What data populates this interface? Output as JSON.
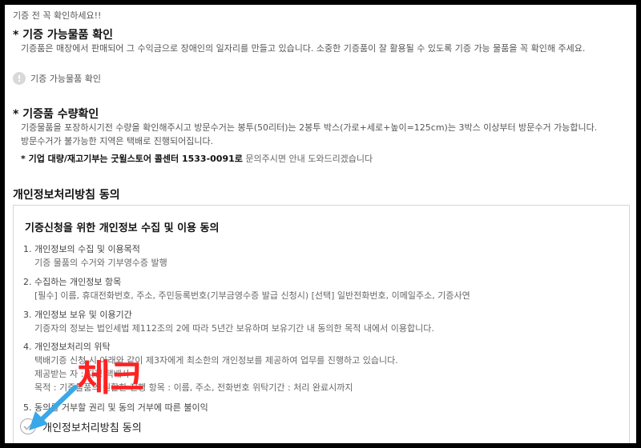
{
  "notice": "기증 전 꼭 확인하세요!!",
  "sections": {
    "goods": {
      "title": "* 기증 가능물품 확인",
      "desc": "기증품은 매장에서 판매되어 그 수익금으로 장애인의 일자리를 만들고 있습니다. 소중한 기증품이 잘 활용될 수 있도록 기증 가능 물품을 꼭 확인해 주세요.",
      "check_label": "기증 가능물품 확인",
      "check_icon": "exclamation-icon"
    },
    "quantity": {
      "title": "* 기증품 수량확인",
      "desc1": "기증물품을 포장하시기전 수량을 확인해주시고 방문수거는 봉투(50리터)는 2봉투 박스(가로+세로+높이=125cm)는 3박스 이상부터 방문수거 가능합니다.",
      "desc2": "방문수거가 불가능한 지역은 택배로 진행되어집니다.",
      "corp_strong": "* 기업 대량/재고기부는 굿윌스토어 콜센터 1533-0091로",
      "corp_weak": " 문의주시면 안내 도와드리겠습니다"
    }
  },
  "privacy": {
    "heading": "개인정보처리방침 동의",
    "box_title": "기증신청을 위한 개인정보 수집 및 이용 동의",
    "items": [
      {
        "h": "1. 개인정보의 수집 및 이용목적",
        "d": [
          "기증 물품의 수거와 기부영수증 발행"
        ]
      },
      {
        "h": "2. 수집하는 개인정보 항목",
        "d": [
          "[필수] 이름, 휴대전화번호, 주소, 주민등록번호(기부금영수증 발급 신청시) [선택] 일반전화번호, 이메일주소, 기증사연"
        ]
      },
      {
        "h": "3. 개인정보 보유 및 이용기간",
        "d": [
          "기증자의 정보는 법인세법 제112조의 2에 따라 5년간 보유하며 보유기간 내 동의한 목적 내에서 이용합니다."
        ]
      },
      {
        "h": "4. 개인정보처리의 위탁",
        "d": [
          "택배기증 신청 시 아래와 같이 제3자에게 최소한의 개인정보를 제공하여 업무를 진행하고 있습니다.",
          "제공받는 자 : 지정 택배사",
          "목적 : 기증물품의 원활한 진행 항목 : 이름, 주소, 전화번호 위탁기간 : 처리 완료시까지"
        ]
      },
      {
        "h": "5. 동의를 거부할 권리 및 동의 거부에 따른 불이익",
        "d": []
      }
    ],
    "agree_label": "개인정보처리방침 동의",
    "checkbox_checked": false
  },
  "annotation": {
    "text": "체크",
    "color": "#ff2222",
    "arrow_color": "#39a8e8"
  }
}
